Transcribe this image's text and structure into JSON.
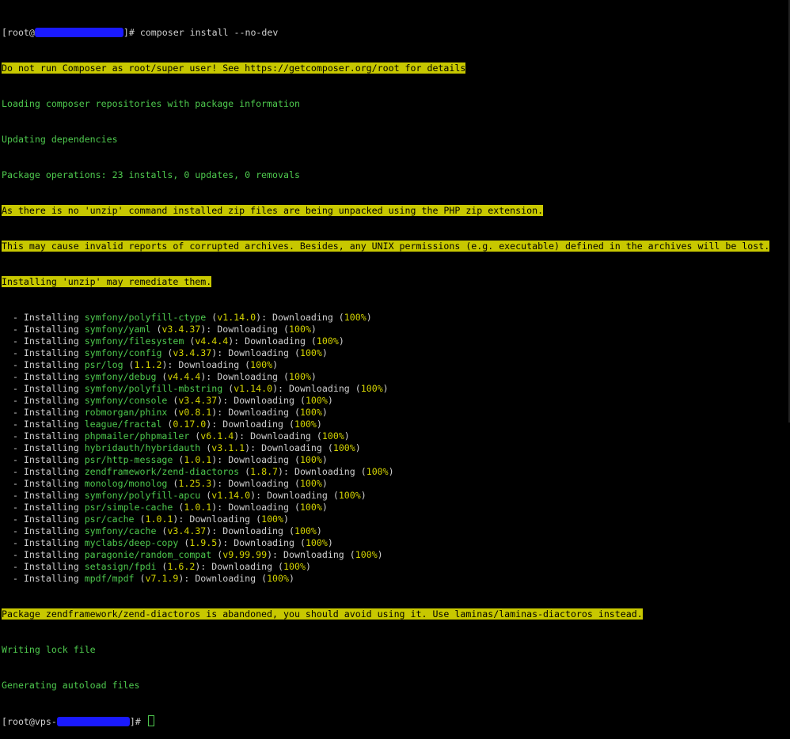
{
  "prompt": {
    "user": "[root@",
    "suffix": "]# ",
    "command": "composer install --no-dev",
    "final_user": "[root@vps-",
    "final_suffix": "]# "
  },
  "warnings": {
    "root": "Do not run Composer as root/super user! See https://getcomposer.org/root for details",
    "unzip1": "As there is no 'unzip' command installed zip files are being unpacked using the PHP zip extension.",
    "unzip2": "This may cause invalid reports of corrupted archives. Besides, any UNIX permissions (e.g. executable) defined in the archives will be lost.",
    "unzip3": "Installing 'unzip' may remediate them.",
    "abandoned": "Package zendframework/zend-diactoros is abandoned, you should avoid using it. Use laminas/laminas-diactoros instead."
  },
  "status": {
    "loading": "Loading composer repositories with package information",
    "updating": "Updating dependencies",
    "operations": "Package operations: 23 installs, 0 updates, 0 removals",
    "writing_lock": "Writing lock file",
    "autoload": "Generating autoload files"
  },
  "install_labels": {
    "prefix": "  - Installing ",
    "downloading": "): Downloading (",
    "percent": "100%",
    "close": ")"
  },
  "packages": [
    {
      "name": "symfony/polyfill-ctype",
      "version": "v1.14.0"
    },
    {
      "name": "symfony/yaml",
      "version": "v3.4.37"
    },
    {
      "name": "symfony/filesystem",
      "version": "v4.4.4"
    },
    {
      "name": "symfony/config",
      "version": "v3.4.37"
    },
    {
      "name": "psr/log",
      "version": "1.1.2"
    },
    {
      "name": "symfony/debug",
      "version": "v4.4.4"
    },
    {
      "name": "symfony/polyfill-mbstring",
      "version": "v1.14.0"
    },
    {
      "name": "symfony/console",
      "version": "v3.4.37"
    },
    {
      "name": "robmorgan/phinx",
      "version": "v0.8.1"
    },
    {
      "name": "league/fractal",
      "version": "0.17.0"
    },
    {
      "name": "phpmailer/phpmailer",
      "version": "v6.1.4"
    },
    {
      "name": "hybridauth/hybridauth",
      "version": "v3.1.1"
    },
    {
      "name": "psr/http-message",
      "version": "1.0.1"
    },
    {
      "name": "zendframework/zend-diactoros",
      "version": "1.8.7"
    },
    {
      "name": "monolog/monolog",
      "version": "1.25.3"
    },
    {
      "name": "symfony/polyfill-apcu",
      "version": "v1.14.0"
    },
    {
      "name": "psr/simple-cache",
      "version": "1.0.1"
    },
    {
      "name": "psr/cache",
      "version": "1.0.1"
    },
    {
      "name": "symfony/cache",
      "version": "v3.4.37"
    },
    {
      "name": "myclabs/deep-copy",
      "version": "1.9.5"
    },
    {
      "name": "paragonie/random_compat",
      "version": "v9.99.99"
    },
    {
      "name": "setasign/fpdi",
      "version": "1.6.2"
    },
    {
      "name": "mpdf/mpdf",
      "version": "v7.1.9"
    }
  ],
  "colors": {
    "background": "#000000",
    "text": "#cfcfcf",
    "highlight": "#c8c800",
    "green": "#4ec94e",
    "yellow": "#d4d400",
    "redaction": "#1a1aff"
  }
}
